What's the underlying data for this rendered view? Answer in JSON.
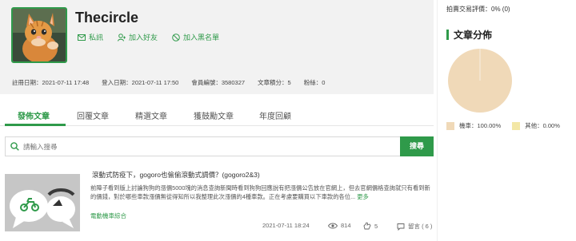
{
  "profile": {
    "username": "Thecircle",
    "actions": [
      {
        "label": "私訊",
        "icon": "mail-icon"
      },
      {
        "label": "加入好友",
        "icon": "add-friend-icon"
      },
      {
        "label": "加入黑名單",
        "icon": "block-icon"
      }
    ],
    "stats": [
      {
        "label": "註冊日期：",
        "value": "2021-07-11 17:48"
      },
      {
        "label": "登入日期：",
        "value": "2021-07-11 17:50"
      },
      {
        "label": "會員編號：",
        "value": "3580327"
      },
      {
        "label": "文章積分：",
        "value": "5"
      },
      {
        "label": "粉絲：",
        "value": "0"
      }
    ]
  },
  "tabs": [
    {
      "label": "發佈文章",
      "active": true
    },
    {
      "label": "回覆文章",
      "active": false
    },
    {
      "label": "精選文章",
      "active": false
    },
    {
      "label": "獲鼓勵文章",
      "active": false
    },
    {
      "label": "年度回顧",
      "active": false
    }
  ],
  "search": {
    "placeholder": "請輸入搜尋",
    "button_label": "搜尋"
  },
  "post": {
    "title": "滾動式防疫下，gogoro也偷偷滾動式調價？(gogoro2&3)",
    "body": "前陣子看到版上討論狗狗的漲價5000塊的消息查詢新聞時看到狗狗回應說有把漲價公告放在官網上，但去官網價格查詢就只有看到新的價錢，對於哪些車款漲價無從得知所以我整理此次漲價的4種車款。正在考慮要購買以下車款的各位...",
    "more_label": "更多",
    "category": "電動機車綜合",
    "date": "2021-07-11 18:24",
    "views": "814",
    "likes": "5",
    "comments": "留言 ( 6 )"
  },
  "sidebar": {
    "rating_label": "拍賣交易評價：",
    "rating_value": "0% (0)",
    "section_title": "文章分佈",
    "legend": [
      {
        "label": "機車：100.00%",
        "color": "#f0d9b8"
      },
      {
        "label": "其他：0.00%",
        "color": "#f3e7a6"
      }
    ]
  },
  "chart_data": {
    "type": "pie",
    "categories": [
      "機車",
      "其他"
    ],
    "values": [
      100.0,
      0.0
    ],
    "colors": [
      "#f0d9b8",
      "#f3e7a6"
    ]
  },
  "colors": {
    "accent": "#2f9a4a"
  }
}
